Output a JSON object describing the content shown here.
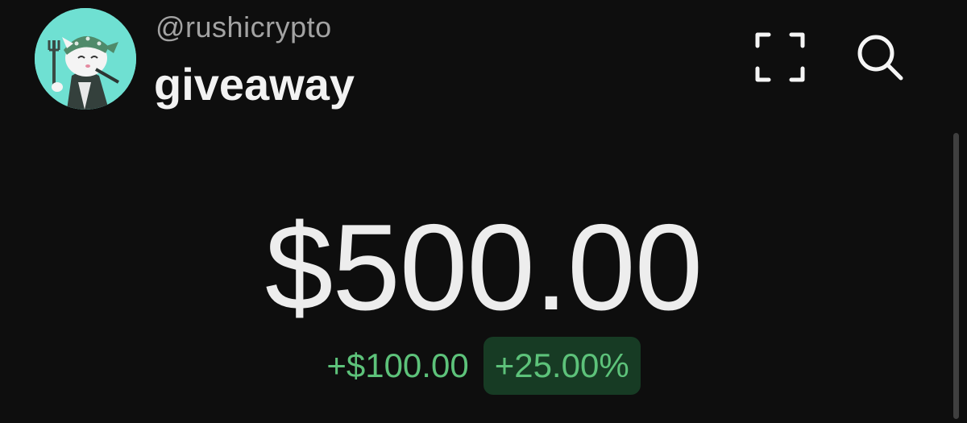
{
  "header": {
    "handle": "@rushicrypto",
    "wallet_name": "giveaway",
    "avatar_icon": "cat-avatar-icon",
    "scan_icon": "scan-frame-icon",
    "search_icon": "search-icon"
  },
  "balance": {
    "amount": "$500.00",
    "change_amount": "+$100.00",
    "change_percent": "+25.00%"
  },
  "colors": {
    "background": "#0e0e0e",
    "positive": "#5dc27a",
    "positive_bg": "#173b24"
  }
}
